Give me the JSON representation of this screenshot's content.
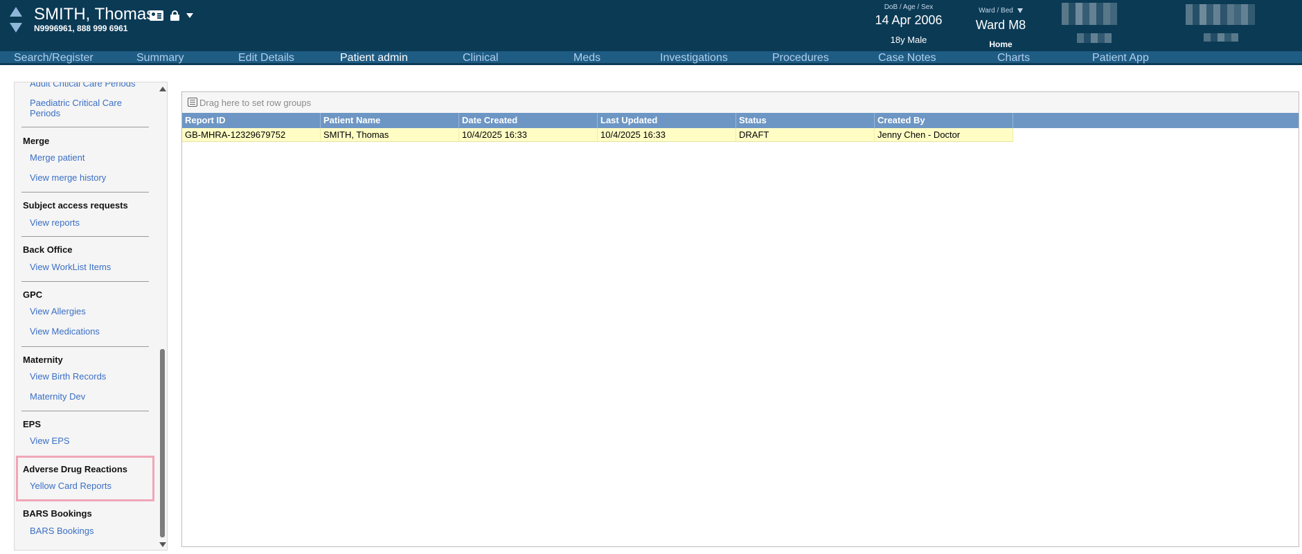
{
  "header": {
    "patient_name": "SMITH, Thomas",
    "patient_ids": "N9996961, 888 999 6961",
    "dob_label": "DoB / Age / Sex",
    "dob_value": "14 Apr 2006",
    "age_sex": "18y Male",
    "ward_label": "Ward / Bed",
    "ward_value": "Ward M8",
    "ward_sub": "Home"
  },
  "nav": {
    "items": [
      {
        "label": "Search/Register"
      },
      {
        "label": "Summary"
      },
      {
        "label": "Edit Details"
      },
      {
        "label": "Patient admin"
      },
      {
        "label": "Clinical"
      },
      {
        "label": "Meds"
      },
      {
        "label": "Investigations"
      },
      {
        "label": "Procedures"
      },
      {
        "label": "Case Notes"
      },
      {
        "label": "Charts"
      },
      {
        "label": "Patient App"
      }
    ],
    "active": "Patient admin"
  },
  "sidebar": {
    "top_partial": "Adult Critical Care Periods",
    "paediatric": "Paediatric Critical Care Periods",
    "merge": {
      "heading": "Merge",
      "links": [
        "Merge patient",
        "View merge history"
      ]
    },
    "sar": {
      "heading": "Subject access requests",
      "links": [
        "View reports"
      ]
    },
    "back_office": {
      "heading": "Back Office",
      "links": [
        "View WorkList Items"
      ]
    },
    "gpc": {
      "heading": "GPC",
      "links": [
        "View Allergies",
        "View Medications"
      ]
    },
    "maternity": {
      "heading": "Maternity",
      "links": [
        "View Birth Records",
        "Maternity Dev"
      ]
    },
    "eps": {
      "heading": "EPS",
      "links": [
        "View EPS"
      ]
    },
    "adr": {
      "heading": "Adverse Drug Reactions",
      "links": [
        "Yellow Card Reports"
      ]
    },
    "bars": {
      "heading": "BARS Bookings",
      "links": [
        "BARS Bookings"
      ]
    }
  },
  "grid": {
    "group_hint": "Drag here to set row groups",
    "columns": [
      "Report ID",
      "Patient Name",
      "Date Created",
      "Last Updated",
      "Status",
      "Created By"
    ],
    "rows": [
      [
        "GB-MHRA-12329679752",
        "SMITH, Thomas",
        "10/4/2025 16:33",
        "10/4/2025 16:33",
        "DRAFT",
        "Jenny Chen - Doctor"
      ]
    ]
  },
  "colors": {
    "header_bg": "#0b3a55",
    "nav_bg": "#1f5c84",
    "link": "#3a6fc4",
    "table_head": "#6d96c4",
    "row_highlight": "#fffdc4",
    "highlight_box": "#f0a6b8"
  }
}
